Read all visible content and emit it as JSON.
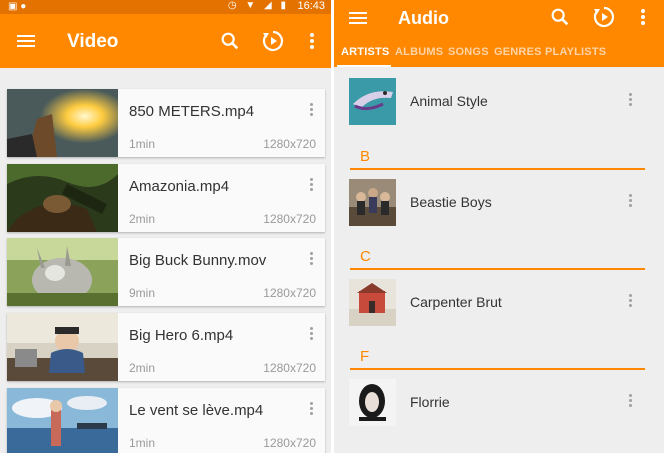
{
  "left_screen": {
    "status_bar": {
      "time": "16:43"
    },
    "toolbar": {
      "title": "Video"
    },
    "videos": [
      {
        "title": "850 METERS.mp4",
        "duration": "1min",
        "resolution": "1280x720"
      },
      {
        "title": "Amazonia.mp4",
        "duration": "2min",
        "resolution": "1280x720"
      },
      {
        "title": "Big Buck Bunny.mov",
        "duration": "9min",
        "resolution": "1280x720"
      },
      {
        "title": "Big Hero 6.mp4",
        "duration": "2min",
        "resolution": "1280x720"
      },
      {
        "title": "Le vent se lève.mp4",
        "duration": "1min",
        "resolution": "1280x720"
      }
    ]
  },
  "right_screen": {
    "toolbar": {
      "title": "Audio"
    },
    "tabs": [
      {
        "label": "ARTISTS",
        "active": true
      },
      {
        "label": "ALBUMS",
        "active": false
      },
      {
        "label": "SONGS",
        "active": false
      },
      {
        "label": "GENRES",
        "active": false
      },
      {
        "label": "PLAYLISTS",
        "active": false
      }
    ],
    "sections": [
      "B",
      "C",
      "F"
    ],
    "artists": [
      {
        "name": "Animal Style"
      },
      {
        "name": "Beastie Boys"
      },
      {
        "name": "Carpenter Brut"
      },
      {
        "name": "Florrie"
      }
    ]
  },
  "colors": {
    "accent": "#ff8800",
    "status_bar": "#e37200",
    "background": "#eeeeee",
    "card": "#fafafa"
  },
  "icons": [
    "menu-icon",
    "search-icon",
    "resume-playback-icon",
    "more-vert-icon"
  ]
}
